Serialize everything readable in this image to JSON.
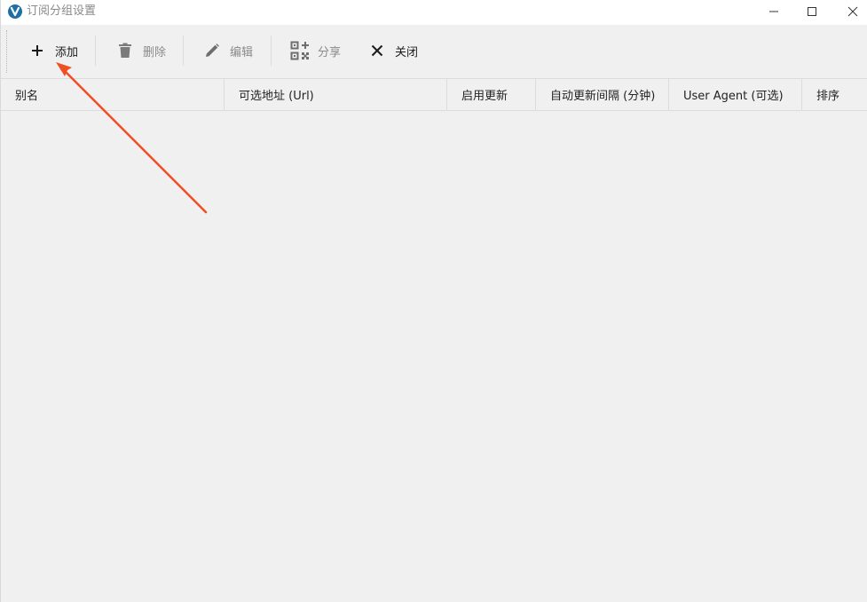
{
  "window": {
    "title": "订阅分组设置"
  },
  "toolbar": {
    "add_label": "添加",
    "delete_label": "删除",
    "edit_label": "编辑",
    "share_label": "分享",
    "close_label": "关闭"
  },
  "table": {
    "columns": [
      "别名",
      "可选地址 (Url)",
      "启用更新",
      "自动更新间隔 (分钟)",
      "User Agent (可选)",
      "排序"
    ],
    "rows": []
  },
  "colors": {
    "accent_icon": "#1e6fa8",
    "annotation_arrow": "#f04e23",
    "background": "#f0f0f0"
  },
  "icons": {
    "add": "plus-icon",
    "delete": "trash-icon",
    "edit": "pencil-icon",
    "share": "qrcode-icon",
    "close": "x-icon"
  }
}
